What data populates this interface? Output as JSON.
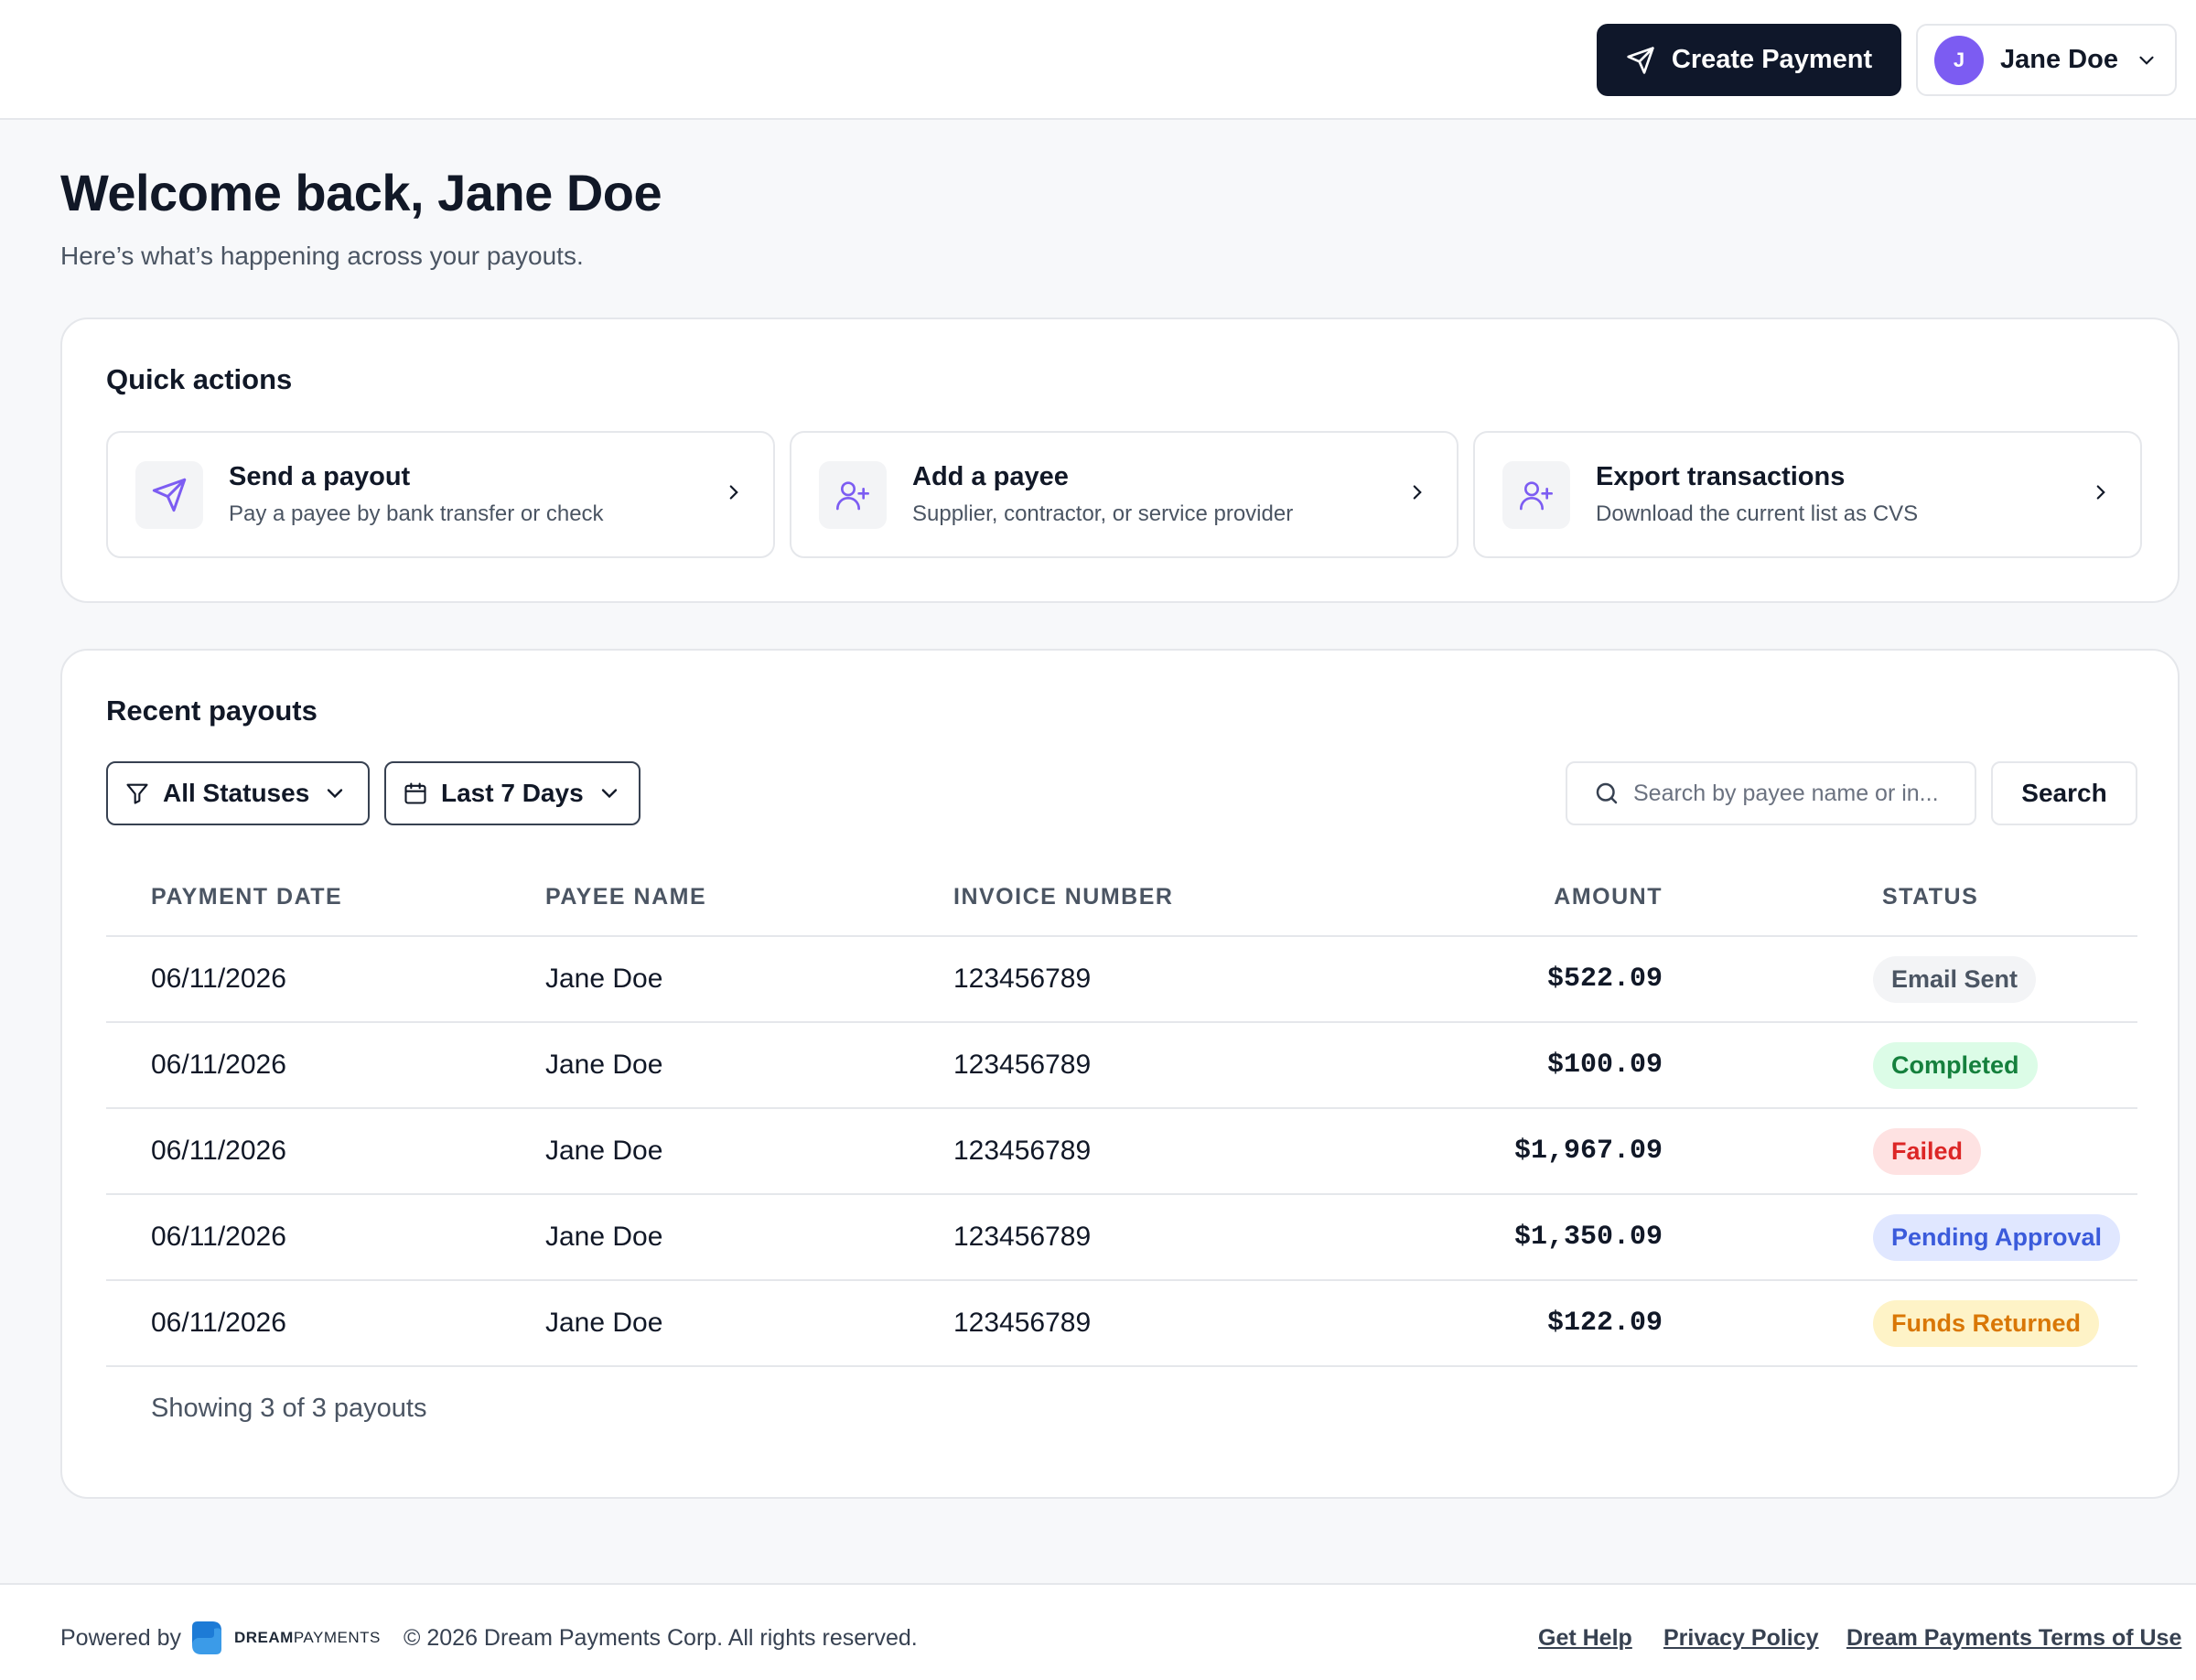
{
  "header": {
    "create_label": "Create Payment",
    "user_initial": "J",
    "user_name": "Jane Doe"
  },
  "welcome": {
    "title": "Welcome back, Jane Doe",
    "subtitle": "Here’s what’s happening across your payouts."
  },
  "quick_actions": {
    "title": "Quick actions",
    "items": [
      {
        "title": "Send a payout",
        "desc": "Pay a payee by bank transfer or check",
        "icon": "send-icon"
      },
      {
        "title": "Add a payee",
        "desc": "Supplier, contractor, or service provider",
        "icon": "user-plus-icon"
      },
      {
        "title": "Export transactions",
        "desc": "Download the current list as CVS",
        "icon": "user-plus-icon"
      }
    ]
  },
  "recent": {
    "title": "Recent payouts",
    "status_filter": "All Statuses",
    "date_filter": "Last 7 Days",
    "search_placeholder": "Search by payee name or in...",
    "search_button": "Search",
    "columns": [
      "PAYMENT DATE",
      "PAYEE NAME",
      "INVOICE NUMBER",
      "AMOUNT",
      "STATUS"
    ],
    "rows": [
      {
        "date": "06/11/2026",
        "payee": "Jane Doe",
        "invoice": "123456789",
        "amount": "$522.09",
        "status": "Email Sent",
        "status_color": "#4b5563",
        "status_bg": "#f3f4f6"
      },
      {
        "date": "06/11/2026",
        "payee": "Jane Doe",
        "invoice": "123456789",
        "amount": "$100.09",
        "status": "Completed",
        "status_color": "#15803d",
        "status_bg": "#dcfce7"
      },
      {
        "date": "06/11/2026",
        "payee": "Jane Doe",
        "invoice": "123456789",
        "amount": "$1,967.09",
        "status": "Failed",
        "status_color": "#dc2626",
        "status_bg": "#fee2e2"
      },
      {
        "date": "06/11/2026",
        "payee": "Jane Doe",
        "invoice": "123456789",
        "amount": "$1,350.09",
        "status": "Pending Approval",
        "status_color": "#3b5bdb",
        "status_bg": "#e0e7ff"
      },
      {
        "date": "06/11/2026",
        "payee": "Jane Doe",
        "invoice": "123456789",
        "amount": "$122.09",
        "status": "Funds Returned",
        "status_color": "#d97706",
        "status_bg": "#fef3c7"
      }
    ],
    "showing": "Showing 3 of 3 payouts"
  },
  "footer": {
    "powered_by": "Powered by",
    "logo_bold": "DREAM",
    "logo_light": "PAYMENTS",
    "copyright": "© 2026 Dream Payments Corp. All rights reserved.",
    "links": [
      "Get Help",
      "Privacy Policy",
      "Dream Payments Terms of Use"
    ]
  },
  "colors": {
    "accent": "#7c5cf2",
    "primary_button": "#0f172a",
    "logo_blue": "#1d7bd6"
  }
}
